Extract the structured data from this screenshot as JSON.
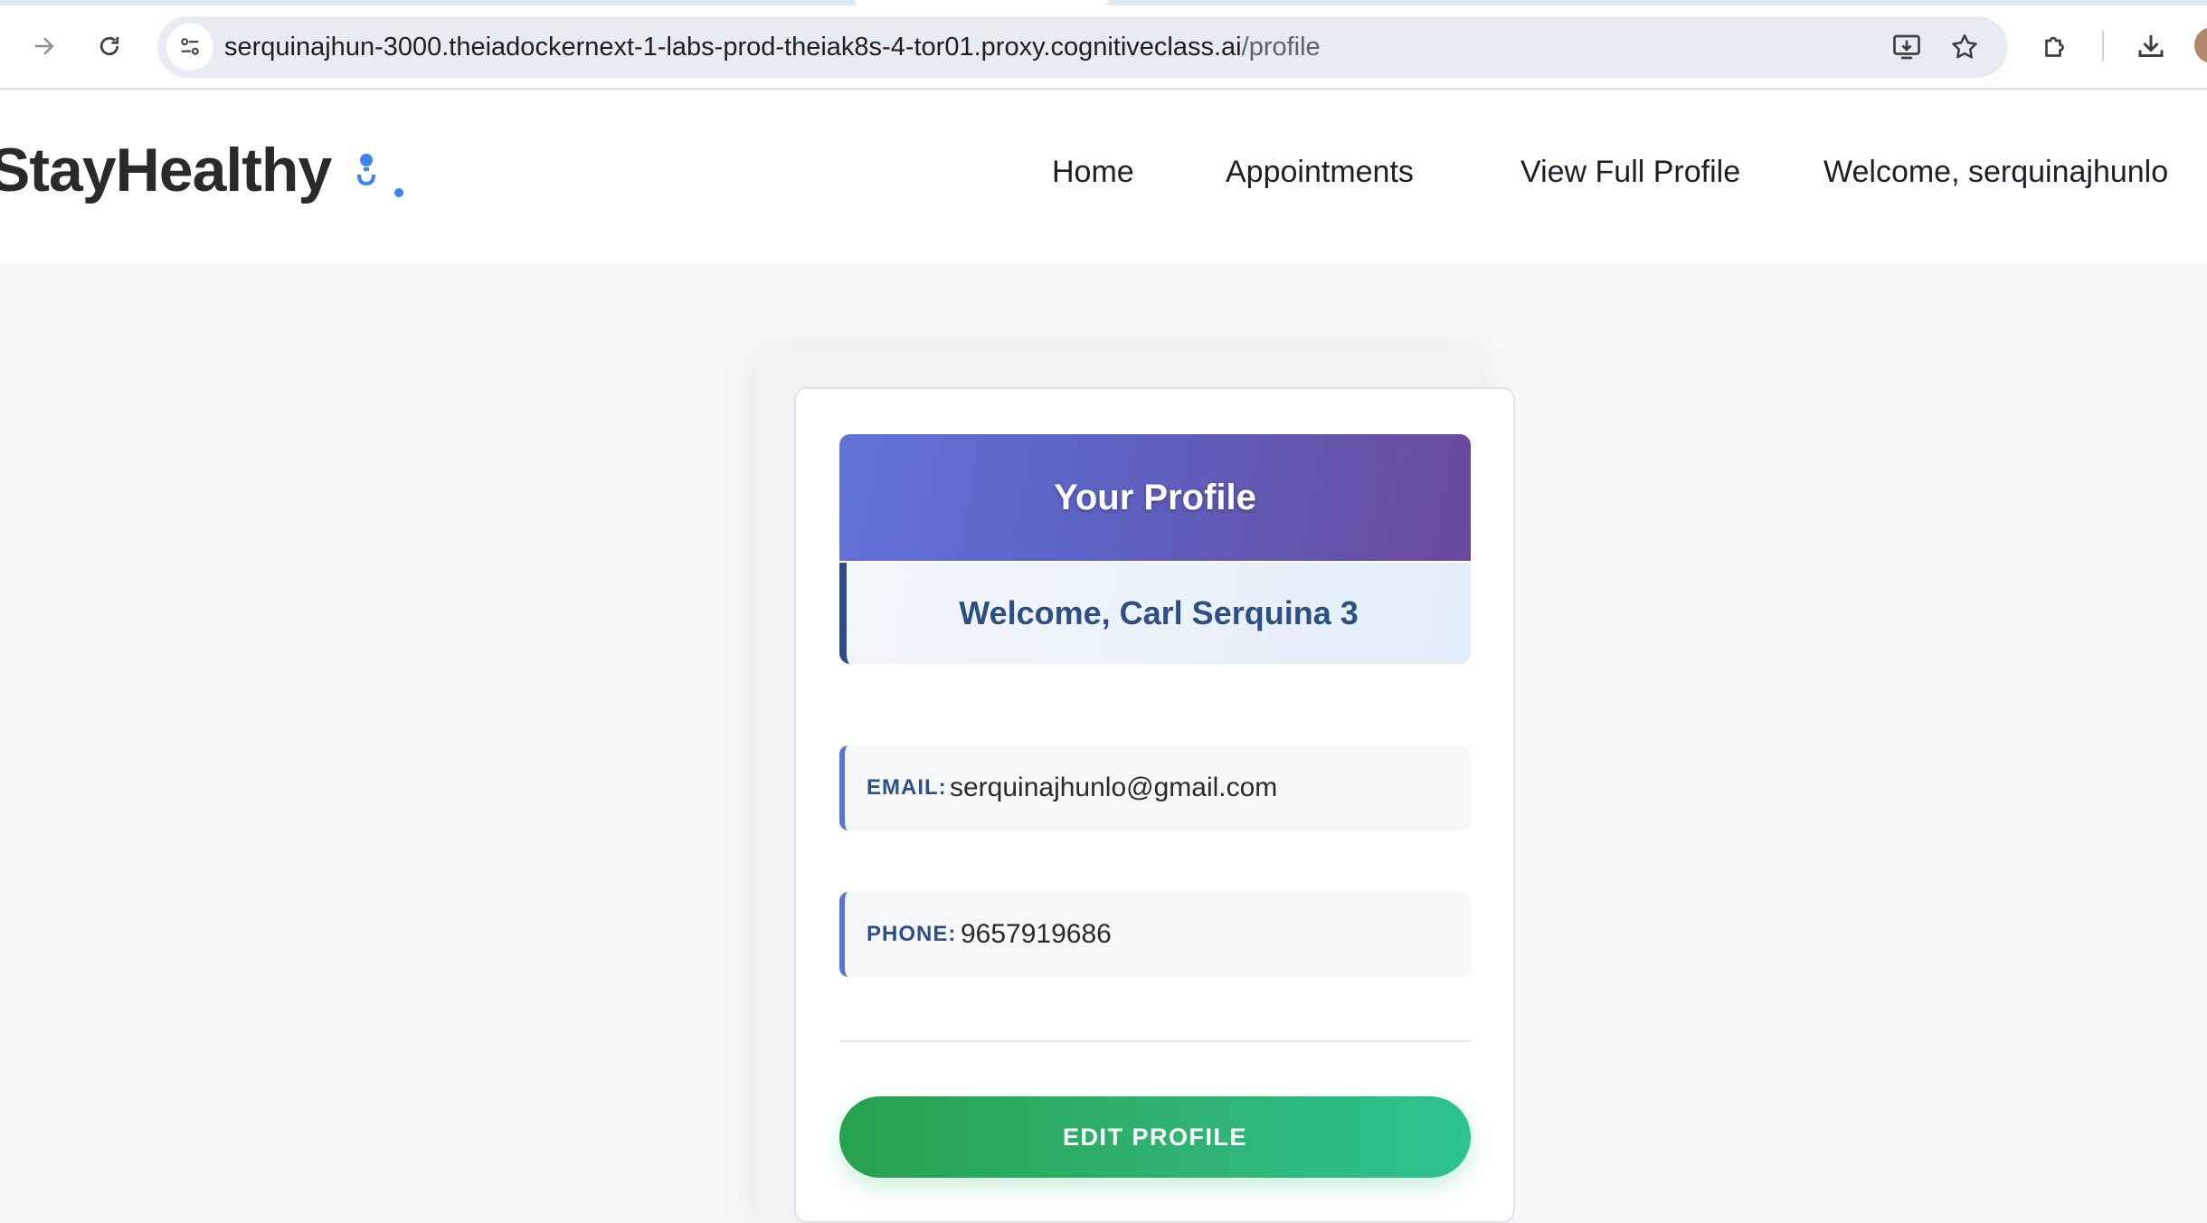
{
  "browser": {
    "url_host": "serquinajhun-3000.theiadockernext-1-labs-prod-theiak8s-4-tor01.proxy.cognitiveclass.ai",
    "url_path": "/profile",
    "icons": [
      "forward-arrow-icon",
      "reload-icon",
      "site-settings-icon",
      "install-app-icon",
      "bookmark-star-icon",
      "extensions-icon",
      "download-icon"
    ]
  },
  "navbar": {
    "brand": "StayHealthy",
    "links": {
      "home": "Home",
      "appointments": "Appointments",
      "view_full_profile": "View Full Profile",
      "welcome": "Welcome, serquinajhunlo"
    }
  },
  "profile": {
    "title": "Your Profile",
    "welcome": "Welcome, Carl Serquina 3",
    "email_label": "EMAIL:",
    "email": "serquinajhunlo@gmail.com",
    "phone_label": "PHONE:",
    "phone": "9657919686",
    "edit_label": "EDIT PROFILE"
  },
  "colors": {
    "header_gradient_start": "#6473d9",
    "header_gradient_end": "#6a4a9c",
    "welcome_text": "#2d4f86",
    "field_accent": "#5b73d6",
    "button_start": "#27a14f",
    "button_end": "#2ec392",
    "brand_icon": "#3b82f6"
  }
}
